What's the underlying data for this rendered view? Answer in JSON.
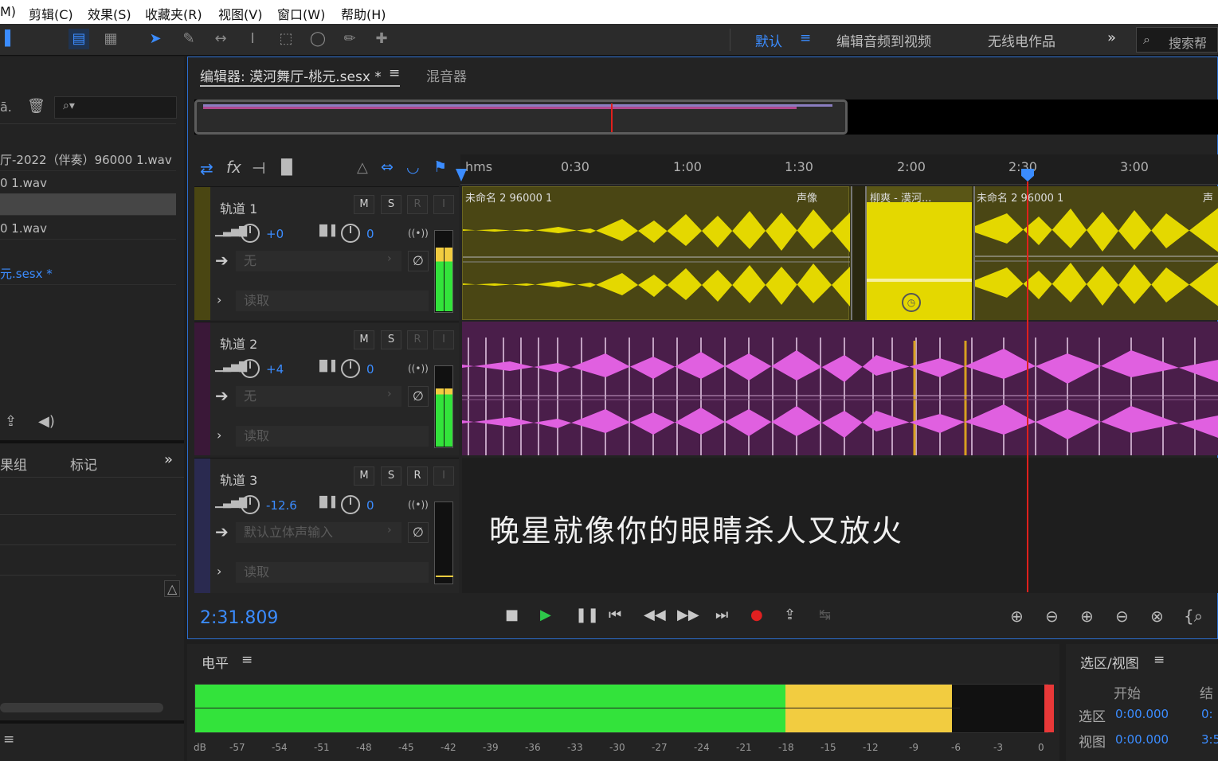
{
  "menu": [
    "M)",
    "剪辑(C)",
    "效果(S)",
    "收藏夹(R)",
    "视图(V)",
    "窗口(W)",
    "帮助(H)"
  ],
  "workspaces": {
    "default": "默认",
    "edit_video": "编辑音频到视频",
    "radio": "无线电作品",
    "search_placeholder": "搜索帮"
  },
  "files": {
    "row1": "厅-2022（伴奏）96000 1.wav",
    "row2": "0 1.wav",
    "row3": "",
    "row4": "0 1.wav",
    "row5": "元.sesx *"
  },
  "left_tabs": {
    "tab1": "果组",
    "tab2": "标记"
  },
  "editor": {
    "tab_title": "编辑器: 漠河舞厅-桃元.sesx *",
    "mixer_tab": "混音器"
  },
  "ruler": {
    "unit": "hms",
    "ticks": [
      "0:30",
      "1:00",
      "1:30",
      "2:00",
      "2:30",
      "3:00"
    ]
  },
  "tracks": [
    {
      "name": "轨道 1",
      "volume": "+0",
      "pan": "0",
      "input": "无",
      "automation": "读取",
      "color": "#6e6a1c",
      "clips": [
        "未命名 2 96000 1",
        "声像",
        "柳爽 - 漠河...",
        "未命名 2 96000 1",
        "声"
      ],
      "meter_level": 0.78
    },
    {
      "name": "轨道 2",
      "volume": "+4",
      "pan": "0",
      "input": "无",
      "automation": "读取",
      "color": "#4a1e4a",
      "meter_level": 0.72
    },
    {
      "name": "轨道 3",
      "volume": "-12.6",
      "pan": "0",
      "input": "默认立体声输入",
      "automation": "读取",
      "color": "#2a2a50",
      "meter_level": 0.0
    }
  ],
  "buttons": {
    "m": "M",
    "s": "S",
    "r": "R",
    "i": "I"
  },
  "lyric": "晚星就像你的眼睛杀人又放火",
  "time_display": "2:31.809",
  "levels": {
    "title": "电平",
    "scale": [
      "dB",
      "-57",
      "-54",
      "-51",
      "-48",
      "-45",
      "-42",
      "-39",
      "-36",
      "-33",
      "-30",
      "-27",
      "-24",
      "-21",
      "-18",
      "-15",
      "-12",
      "-9",
      "-6",
      "-3",
      "0"
    ],
    "green_to_db": -18,
    "yellow_to_db": -6
  },
  "selection": {
    "title": "选区/视图",
    "col_start": "开始",
    "col_end": "结",
    "sel_label": "选区",
    "sel_start": "0:00.000",
    "sel_end": "0:",
    "view_label": "视图",
    "view_start": "0:00.000",
    "view_end": "3:5"
  },
  "colors": {
    "accent": "#3b8cff",
    "track1_wave": "#e4d800",
    "track2_wave": "#e060e0",
    "playhead": "#e0201c",
    "meter_green": "#33e33b",
    "meter_yellow": "#f2cc40",
    "meter_red": "#e83838"
  }
}
